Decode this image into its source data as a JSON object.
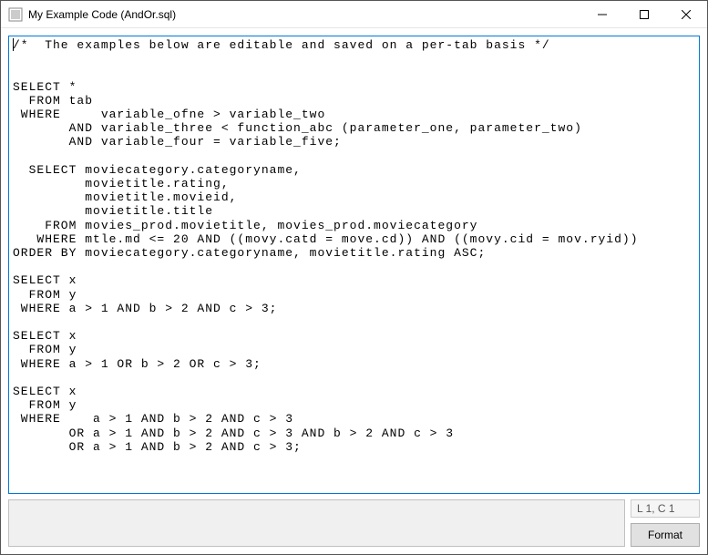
{
  "window": {
    "title": "My Example Code (AndOr.sql)"
  },
  "editor": {
    "content": "/*  The examples below are editable and saved on a per-tab basis */\n\n\nSELECT *\n  FROM tab\n WHERE     variable_ofne > variable_two\n       AND variable_three < function_abc (parameter_one, parameter_two)\n       AND variable_four = variable_five;\n\n  SELECT moviecategory.categoryname,\n         movietitle.rating,\n         movietitle.movieid,\n         movietitle.title\n    FROM movies_prod.movietitle, movies_prod.moviecategory\n   WHERE mtle.md <= 20 AND ((movy.catd = move.cd)) AND ((movy.cid = mov.ryid))\nORDER BY moviecategory.categoryname, movietitle.rating ASC;\n\nSELECT x\n  FROM y\n WHERE a > 1 AND b > 2 AND c > 3;\n\nSELECT x\n  FROM y\n WHERE a > 1 OR b > 2 OR c > 3;\n\nSELECT x\n  FROM y\n WHERE    a > 1 AND b > 2 AND c > 3\n       OR a > 1 AND b > 2 AND c > 3 AND b > 2 AND c > 3\n       OR a > 1 AND b > 2 AND c > 3;"
  },
  "status": {
    "position": "L 1, C 1"
  },
  "buttons": {
    "format": "Format"
  }
}
